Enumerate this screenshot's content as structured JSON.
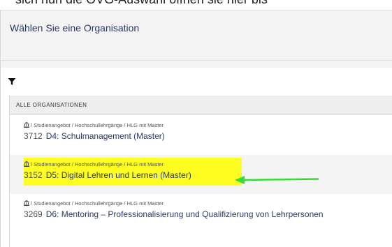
{
  "caption": {
    "text": "sich nun die OVG-Auswahl öffnen sie hier bis"
  },
  "dialog": {
    "title": "Wählen Sie eine Organisation"
  },
  "filter": {
    "icon": "filter-icon"
  },
  "list": {
    "section_label": "ALLE ORGANISATIONEN",
    "items": [
      {
        "path": "/ Studienangebot / Hochschullehrgänge / HLG mit Master",
        "id": "3712",
        "name": "D4: Schulmanagement (Master)",
        "highlighted": false
      },
      {
        "path": "/ Studienangebot / Hochschullehrgänge / HLG mit Master",
        "id": "3152",
        "name": "D5: Digital Lehren und Lernen (Master)",
        "highlighted": true
      },
      {
        "path": "/ Studienangebot / Hochschullehrgänge / HLG mit Master",
        "id": "3269",
        "name": "D6: Mentoring – Professionalisierung und Qualifizierung von Lehrpersonen",
        "highlighted": false
      }
    ]
  },
  "colors": {
    "highlight": "#fdfd1f",
    "arrow": "#33dd33",
    "title": "#2b3a67"
  },
  "icons": {
    "institution": "institution-icon",
    "annotation_arrow": "arrow-left-icon"
  }
}
